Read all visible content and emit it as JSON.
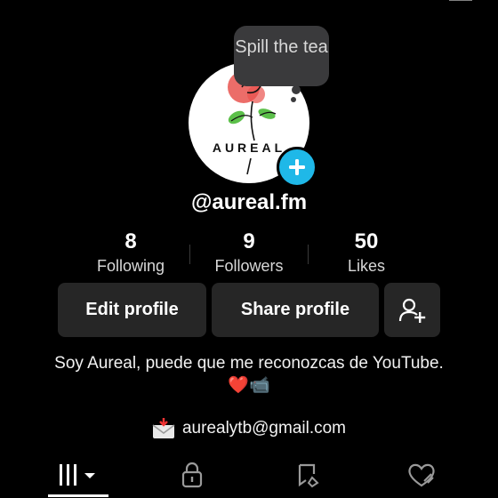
{
  "profile": {
    "avatar_wordmark": "AUREAL",
    "bubble_text": "Spill the tea",
    "username": "@aureal.fm"
  },
  "stats": [
    {
      "value": "8",
      "label": "Following"
    },
    {
      "value": "9",
      "label": "Followers"
    },
    {
      "value": "50",
      "label": "Likes"
    }
  ],
  "actions": {
    "edit_profile": "Edit profile",
    "share_profile": "Share profile"
  },
  "bio": {
    "text": "Soy Aureal, puede que me reconozcas de YouTube. ❤️📹",
    "email": "aurealytb@gmail.com"
  },
  "icons": {
    "top_1": "glasses-icon",
    "top_2": "menu-icon",
    "add_avatar": "plus-icon",
    "add_friend": "add-user-icon",
    "email": "envelope-icon",
    "tab_videos": "grid-icon",
    "tab_private": "lock-icon",
    "tab_reposts": "repost-icon",
    "tab_liked": "heart-icon"
  },
  "colors": {
    "background": "#000000",
    "button_bg": "#262626",
    "badge_blue": "#1fb8e8",
    "text_muted": "#d8d8d8"
  }
}
